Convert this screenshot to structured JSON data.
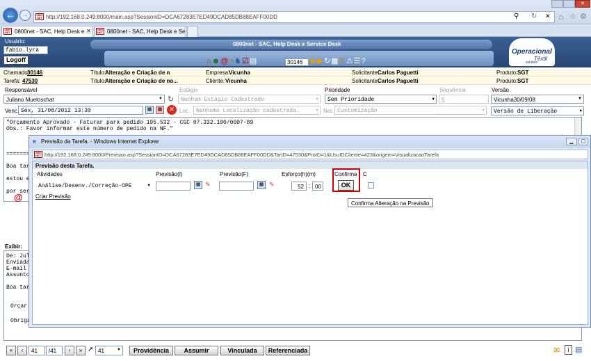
{
  "browser": {
    "address": "http://192.168.0.249:8000/main.asp?SessionID=DCA67283E7ED49DCAD85DB88EAFF00DD",
    "address_host": "192.168.0.249",
    "tabs": [
      {
        "label": "0800net - SAC, Help Desk e ..."
      },
      {
        "label": "0800net - SAC, Help Desk e Ser..."
      }
    ],
    "tab_close": "✕"
  },
  "app": {
    "title": "0800net - SAC, Help Desk e Service Desk",
    "usuario_label": "Usuário:",
    "usuario_value": "fabio.lyra",
    "logoff_label": "Logoff",
    "counter_value": "30146",
    "brand_line1": "Operacional",
    "brand_line2": "Têxtil",
    "brand_line3": "solution"
  },
  "info": {
    "row1": {
      "chamado_label": "Chamado:",
      "chamado_value": "30146",
      "titulo_label": "Título:",
      "titulo_value": "Alteração e Criação de n",
      "empresa_label": "Empresa:",
      "empresa_value": "Vicunha",
      "solicitante_label": "Solicitante:",
      "solicitante_value": "Carlos Paguetti",
      "produto_label": "Produto:",
      "produto_value": "SGT"
    },
    "row2": {
      "tarefa_label": "Tarefa:",
      "tarefa_value": "47530",
      "titulo_label": "Título:",
      "titulo_value": "Alteração e Criação de no...",
      "cliente_label": "Cliente:",
      "cliente_value": "Vicunha",
      "solicitante_label": "Solicitante:",
      "solicitante_value": "Carlos Paguetti",
      "produto_label": "Produto:",
      "produto_value": "SGT"
    }
  },
  "form": {
    "responsavel_label": "Responsável",
    "responsavel_value": "Juliano Mueloschat",
    "estagio_label": "Estágio",
    "estagio_value": "Nenhum Estágio Cadastrado",
    "prioridade_label": "Prioridade",
    "prioridade_value": "Sem Prioridade",
    "sequencia_label": "Sequência",
    "sequencia_value": "5",
    "versao_label": "Versão",
    "versao_value": "Vicunha30/09/08",
    "venc_label": "Venc.",
    "venc_value": "Sex, 31/08/2012 13:30",
    "loc_label": "Loc.",
    "loc_value": "Nenhuma Localização cadastrada.",
    "nat_label": "Nat.",
    "nat_value": "Customização",
    "versao_lib_value": "Versão de Liberação"
  },
  "textarea": {
    "line1": "\"Orçamento Aprovado - Faturar para pedido 195.532 - CGC 07.332.190/0007-89",
    "line2": "Obs.: Favor informar este número de pedido na NF.\"",
    "line3": "=======",
    "line4": "Boa tar",
    "line5": "estou e",
    "line6": "por ser"
  },
  "lower": {
    "exibir_label": "Exibir:",
    "line1": "De: Jul",
    "line2": "Enviada",
    "line3": "E-mail",
    "line4": "Assunto",
    "line5": "Boa tar",
    "line6": "Orçar",
    "line7": "Obriga"
  },
  "popup": {
    "window_title": "Previsão da Tarefa. - Windows Internet Explorer",
    "address": "http://192.168.0.249:8000/Previsao.asp?SessionID=DCA67283E7ED49DCAD85DB88EAFF00DD&TarID=47530&ProID=1&UsuIDCliente=423&origem=VisualizacaoTarefa",
    "address_host": "192.168.0.249",
    "section_title": "Previsão desta Tarefa.",
    "col_atividades": "Atividades",
    "col_previsao_i": "Previsão(I)",
    "col_previsao_f": "Previsão(F)",
    "col_esforco": "Esforço(h)(m)",
    "col_confirma": "Confirma",
    "col_c": "C",
    "atividade_value": "Análise/Desenv./Correção-OPE",
    "previsao_i_value": "",
    "previsao_f_value": "",
    "esforco_h": "52",
    "esforco_sep": ":",
    "esforco_m": "00",
    "ok_label": "OK",
    "criar_link": "Criar Previsão",
    "tooltip": "Confirma Alteração na Previsão"
  },
  "bottom": {
    "first": "«",
    "prev": "‹",
    "page_current": "41",
    "page_total": "/41",
    "next": "›",
    "last": "»",
    "goto_value": "41",
    "btn_providencia": "Providência",
    "btn_assumir": "Assumir",
    "btn_vinculada": "Vinculada",
    "btn_referenciada": "Referenciada"
  },
  "colors": {
    "header_blue": "#2f5283",
    "highlight_red": "#cc0000",
    "info_bar": "#fffbe6"
  }
}
